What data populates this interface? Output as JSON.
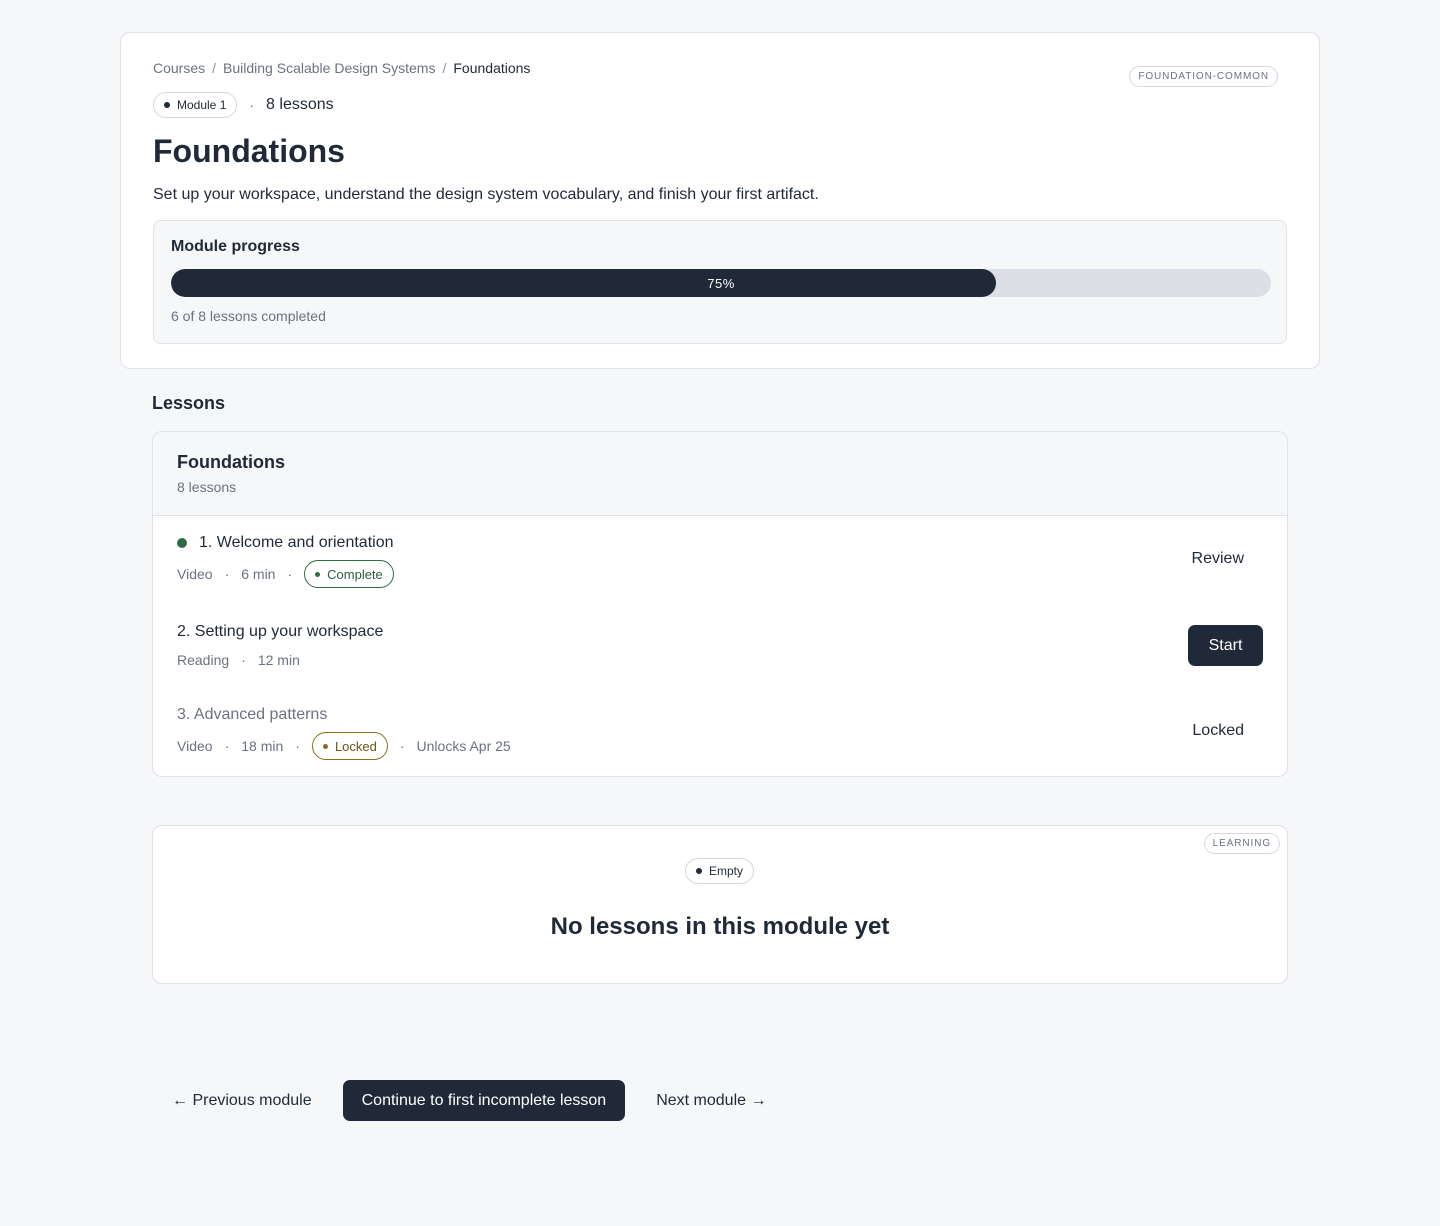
{
  "breadcrumb": {
    "items": [
      "Courses",
      "Building Scalable Design Systems",
      "Foundations"
    ],
    "separator": "/"
  },
  "header": {
    "tag": "FOUNDATION-COMMON",
    "module_badge": "Module 1",
    "separator": "·",
    "lesson_count": "8 lessons",
    "title": "Foundations",
    "description": "Set up your workspace, understand the design system vocabulary, and finish your first artifact."
  },
  "progress": {
    "label": "Module progress",
    "percent": 75,
    "percent_label": "75%",
    "summary": "6 of 8 lessons completed"
  },
  "lessons_section": {
    "heading": "Lessons",
    "group_title": "Foundations",
    "group_count": "8 lessons",
    "items": [
      {
        "title": "1. Welcome and orientation",
        "type": "Video",
        "duration": "6 min",
        "badge": "Complete",
        "action": "Review",
        "status": "complete"
      },
      {
        "title": "2. Setting up your workspace",
        "type": "Reading",
        "duration": "12 min",
        "action": "Start",
        "status": "available"
      },
      {
        "title": "3. Advanced patterns",
        "type": "Video",
        "duration": "18 min",
        "badge": "Locked",
        "unlock_note": "Unlocks Apr 25",
        "action": "Locked",
        "status": "locked"
      }
    ],
    "meta_separator": "·"
  },
  "empty_state": {
    "tag": "LEARNING",
    "badge": "Empty",
    "title": "No lessons in this module yet"
  },
  "footer": {
    "prev_label": "Previous module",
    "prev_icon": "arrow-left-icon",
    "continue_label": "Continue to first incomplete lesson",
    "next_label": "Next module",
    "next_icon": "arrow-right-icon"
  },
  "colors": {
    "background": "#f6f7f9",
    "primary": "#1f2937",
    "complete": "#2f6b46",
    "locked": "#8a6d1f"
  }
}
